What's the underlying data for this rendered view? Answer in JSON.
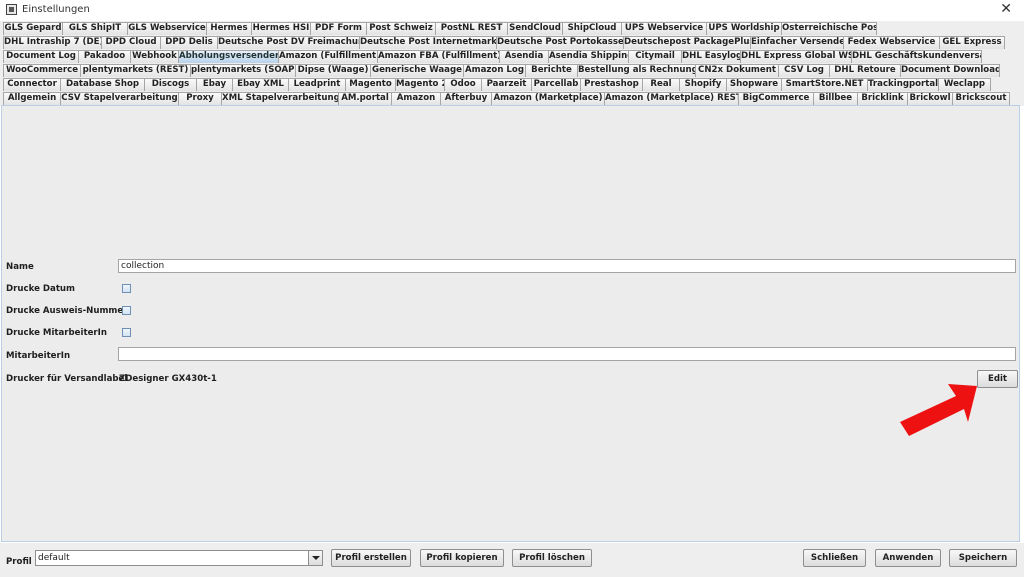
{
  "window": {
    "title": "Einstellungen",
    "close_glyph": "✕"
  },
  "tabs": {
    "row1": [
      "GLS Gepard",
      "GLS ShipIT",
      "GLS Webservice",
      "Hermes",
      "Hermes HSI",
      "PDF Form",
      "Post Schweiz",
      "PostNL REST",
      "SendCloud",
      "ShipCloud",
      "UPS Webservice",
      "UPS Worldship",
      "Österreichische Post"
    ],
    "row2": [
      "DHL Intraship 7 (DE)",
      "DPD Cloud",
      "DPD Delis",
      "Deutsche Post DV Freimachung",
      "Deutsche Post Internetmarke",
      "Deutsche Post Portokasse",
      "Deutschepost PackagePlus",
      "Einfacher Versender",
      "Fedex Webservice",
      "GEL Express"
    ],
    "row3": [
      "Document Log",
      "Pakadoo",
      "Webhook",
      "Abholungsversender",
      "Amazon (Fulfillment)",
      "Amazon FBA (Fulfillment)",
      "Asendia",
      "Asendia Shipping",
      "Citymail",
      "DHL Easylog",
      "DHL Express Global WS",
      "DHL Geschäftskundenversand"
    ],
    "row4": [
      "WooCommerce",
      "plentymarkets (REST)",
      "plentymarkets (SOAP)",
      "Dipse (Waage)",
      "Generische Waage",
      "Amazon Log",
      "Berichte",
      "Bestellung als Rechnung",
      "CN2x Dokument",
      "CSV Log",
      "DHL Retoure",
      "Document Downloader"
    ],
    "row5": [
      "Connector",
      "Database Shop",
      "Discogs",
      "Ebay",
      "Ebay XML",
      "Leadprint",
      "Magento",
      "Magento 2",
      "Odoo",
      "Paarzeit",
      "Parcellab",
      "Prestashop",
      "Real",
      "Shopify",
      "Shopware",
      "SmartStore.NET",
      "Trackingportal",
      "Weclapp"
    ],
    "row6": [
      "Allgemein",
      "CSV Stapelverarbeitung",
      "Proxy",
      "XML Stapelverarbeitung",
      "AM.portal",
      "Amazon",
      "Afterbuy",
      "Amazon (Marketplace)",
      "Amazon (Marketplace) REST",
      "BigCommerce",
      "Billbee",
      "Bricklink",
      "Brickowl",
      "Brickscout"
    ],
    "active": "Abholungsversender"
  },
  "form": {
    "name_label": "Name",
    "name_value": "collection",
    "drucke_datum_label": "Drucke Datum",
    "drucke_ausweis_label": "Drucke Ausweis-Nummer",
    "drucke_mitarbeiter_label": "Drucke MitarbeiterIn",
    "mitarbeiter_label": "MitarbeiterIn",
    "mitarbeiter_value": "",
    "drucker_label": "Drucker für Versandlabel",
    "drucker_value": "ZDesigner GX430t-1",
    "edit_button": "Edit"
  },
  "annotation": {
    "arrow_color": "#ee1111"
  },
  "bottom": {
    "profile_label": "Profil",
    "profile_value": "default",
    "profil_erstellen": "Profil erstellen",
    "profil_kopieren": "Profil kopieren",
    "profil_loeschen": "Profil löschen",
    "schliessen": "Schließen",
    "anwenden": "Anwenden",
    "speichern": "Speichern"
  }
}
